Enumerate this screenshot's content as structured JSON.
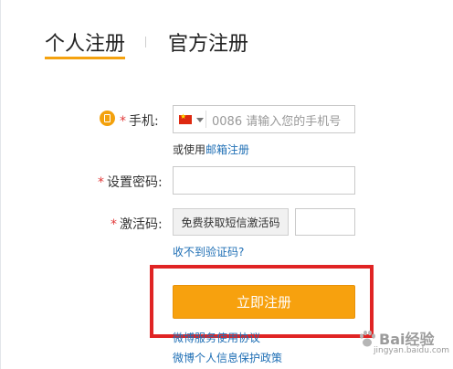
{
  "tabs": {
    "personal": "个人注册",
    "official": "官方注册"
  },
  "form": {
    "phone_label": "手机:",
    "phone_code": "0086",
    "phone_placeholder": "请输入您的手机号",
    "alt_prefix": "或使用",
    "alt_link": "邮箱注册",
    "password_label": "设置密码:",
    "activation_label": "激活码:",
    "sms_button": "免费获取短信激活码",
    "no_code_link": "收不到验证码?",
    "submit": "立即注册",
    "agreement_1": "微博服务使用协议",
    "agreement_2": "微博个人信息保护政策",
    "required_mark": "*"
  },
  "watermark": {
    "brand": "Bai经验",
    "url": "jingyan.baidu.com"
  },
  "colors": {
    "accent": "#f7a10e",
    "link": "#1f6fb5",
    "highlight": "#e02424",
    "required": "#e23a3a"
  }
}
